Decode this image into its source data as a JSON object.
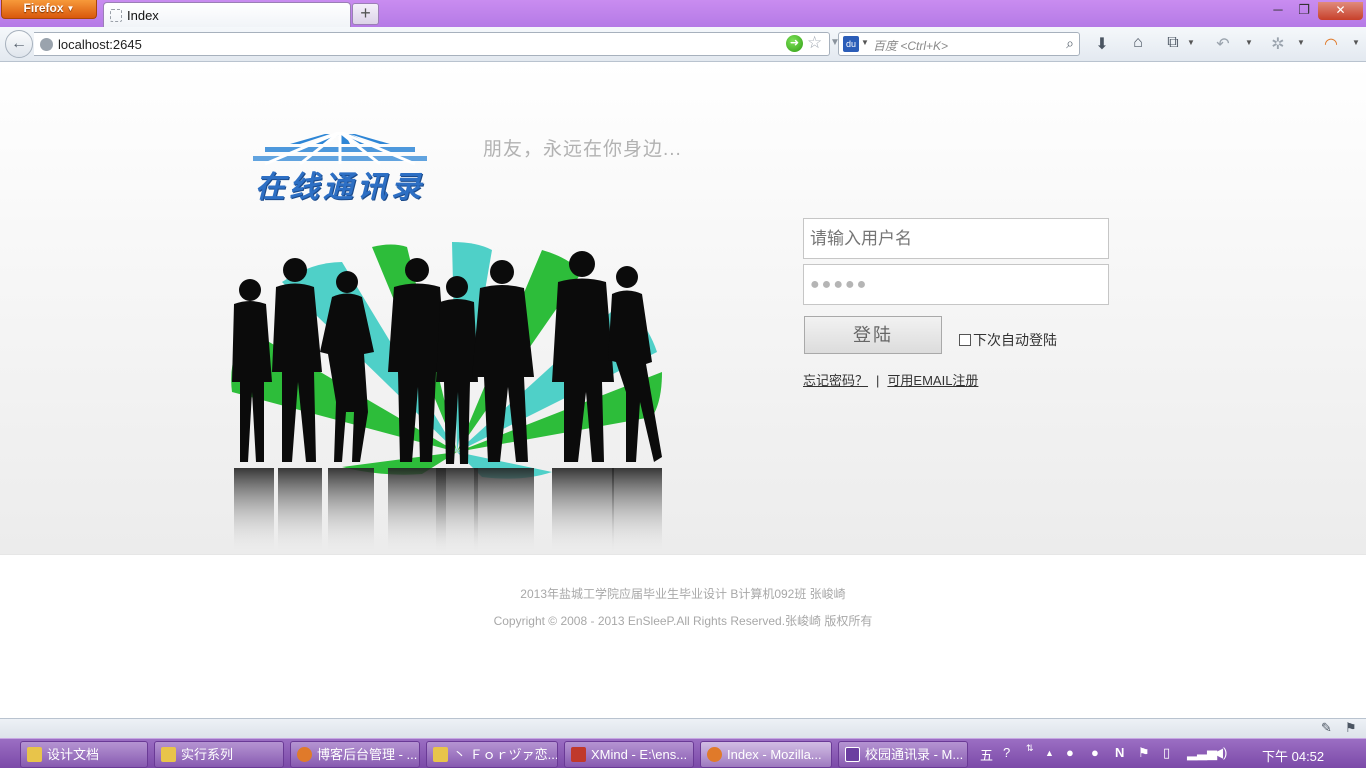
{
  "browser": {
    "app_button": "Firefox",
    "tab_title": "Index",
    "new_tab": "+",
    "url": "localhost:2645",
    "search_placeholder": "百度 <Ctrl+K>"
  },
  "page": {
    "logo_text": "在线通讯录",
    "slogan": "朋友，永远在你身边...",
    "login": {
      "username_placeholder": "请输入用户名",
      "password_value": "●●●●●",
      "login_button": "登陆",
      "remember_label": "下次自动登陆",
      "forgot_link": "忘记密码？",
      "separator": "|",
      "register_link": "可用EMAIL注册"
    },
    "footer_line1": "2013年盐城工学院应届毕业生毕业设计 B计算机092班 张峻崎",
    "footer_line2": "Copyright © 2008 - 2013 EnSleeP.All Rights Reserved.张峻崎 版权所有"
  },
  "taskbar": {
    "items": [
      {
        "label": "设计文档",
        "icon": "folder-icon",
        "color": "#e8c44a"
      },
      {
        "label": "实行系列",
        "icon": "folder-icon",
        "color": "#e8c44a"
      },
      {
        "label": "博客后台管理 - ...",
        "icon": "firefox-icon",
        "color": "#e07a2a"
      },
      {
        "label": "丶 Ｆｏｒヅァ恋...",
        "icon": "folder-icon",
        "color": "#e8c44a"
      },
      {
        "label": "XMind - E:\\ens...",
        "icon": "xmind-icon",
        "color": "#c0392b"
      },
      {
        "label": "Index - Mozilla...",
        "icon": "firefox-icon",
        "color": "#e07a2a"
      },
      {
        "label": "校园通讯录 - M...",
        "icon": "visual-studio-icon",
        "color": "#6b3fa0"
      }
    ],
    "clock": "下午 04:52",
    "ime": "五"
  }
}
